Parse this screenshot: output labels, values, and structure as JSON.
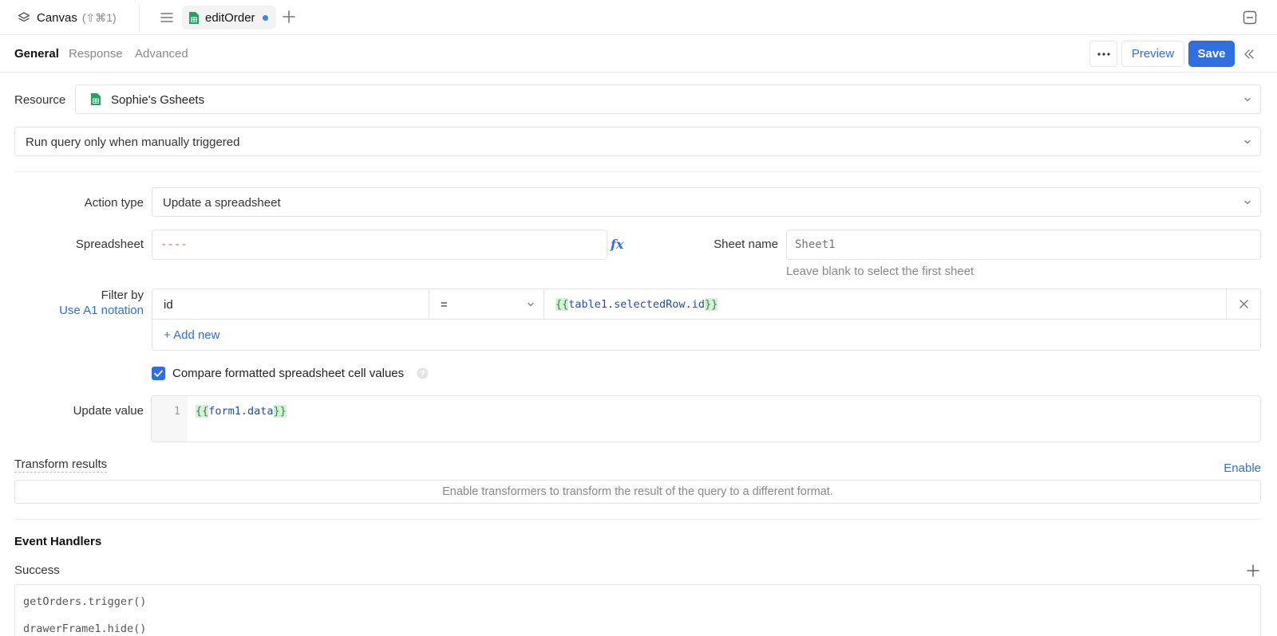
{
  "topbar": {
    "canvas_label": "Canvas",
    "canvas_shortcut": "(⇧⌘1)",
    "file_tab": "editOrder"
  },
  "subheader": {
    "tabs": [
      "General",
      "Response",
      "Advanced"
    ],
    "active_tab": "General",
    "more_label": "•••",
    "preview_label": "Preview",
    "save_label": "Save"
  },
  "form": {
    "resource_label": "Resource",
    "resource_value": "Sophie's Gsheets",
    "trigger_value": "Run query only when manually triggered",
    "action_type_label": "Action type",
    "action_type_value": "Update a spreadsheet",
    "spreadsheet_label": "Spreadsheet",
    "spreadsheet_value": "----",
    "fx_label": "fx",
    "sheet_name_label": "Sheet name",
    "sheet_name_placeholder": "Sheet1",
    "sheet_name_hint": "Leave blank to select the first sheet",
    "filter_label": "Filter by",
    "a1_link": "Use A1 notation",
    "filter": {
      "column": "id",
      "operator": "=",
      "value_open": "{{",
      "value_expr": "table1.selectedRow.id",
      "value_close": "}}"
    },
    "add_new_label": "+ Add new",
    "compare_label": "Compare formatted spreadsheet cell values",
    "compare_checked": true,
    "update_value_label": "Update value",
    "update_line_number": "1",
    "update_open": "{{",
    "update_expr": "form1.data",
    "update_close": "}}"
  },
  "transform": {
    "title": "Transform results",
    "enable_label": "Enable",
    "description": "Enable transformers to transform the result of the query to a different format."
  },
  "events": {
    "title": "Event Handlers",
    "success_label": "Success",
    "handlers": [
      "getOrders.trigger()",
      "drawerFrame1.hide()"
    ]
  },
  "colors": {
    "accent": "#2f6fe0",
    "sheets_green": "#1ea362",
    "code_green": "#2e8b3c",
    "code_blue": "#1f4fa8"
  }
}
